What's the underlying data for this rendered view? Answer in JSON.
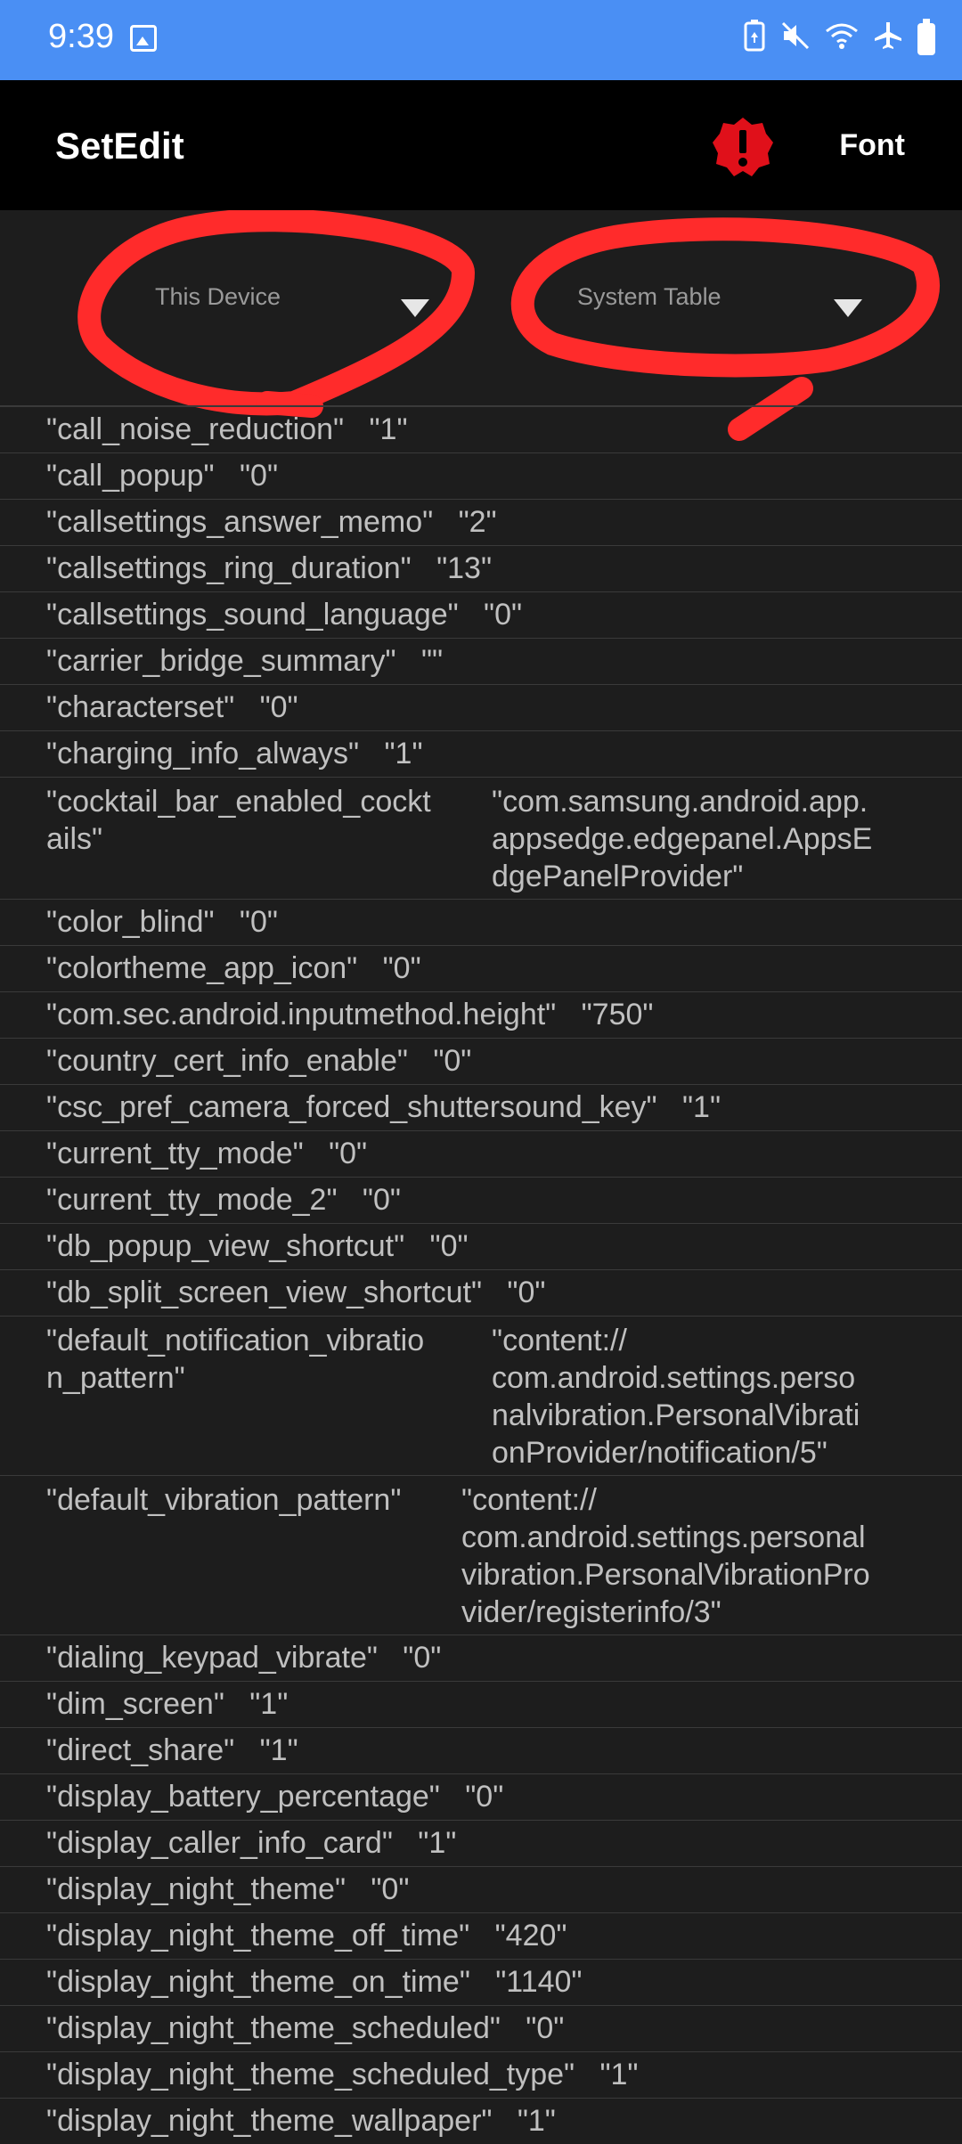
{
  "status_bar": {
    "time": "9:39",
    "icons": [
      "gallery-icon",
      "battery-saver-icon",
      "mute-icon",
      "wifi-icon",
      "airplane-icon",
      "battery-icon"
    ]
  },
  "app_bar": {
    "title": "SetEdit",
    "alert_icon": "alert-icon",
    "font_label": "Font"
  },
  "spinners": {
    "device": "This Device",
    "table": "System Table"
  },
  "colors": {
    "status_bar": "#4a8ff4",
    "app_bar": "#000000",
    "background": "#1d1d1d",
    "annotation": "#ff2b2b",
    "alert": "#e0101a"
  },
  "rows": [
    {
      "key": "\"call_noise_reduction\"",
      "value": "\"1\""
    },
    {
      "key": "\"call_popup\"",
      "value": "\"0\""
    },
    {
      "key": "\"callsettings_answer_memo\"",
      "value": "\"2\""
    },
    {
      "key": "\"callsettings_ring_duration\"",
      "value": "\"13\""
    },
    {
      "key": "\"callsettings_sound_language\"",
      "value": "\"0\""
    },
    {
      "key": "\"carrier_bridge_summary\"",
      "value": "\"\""
    },
    {
      "key": "\"characterset\"",
      "value": "\"0\""
    },
    {
      "key": "\"charging_info_always\"",
      "value": "\"1\""
    },
    {
      "key": "\"cocktail_bar_enabled_cockt\nails\"",
      "value": "\"com.samsung.android.app.\nappsedge.edgepanel.AppsE\ndgePanelProvider\"",
      "multi": true
    },
    {
      "key": "\"color_blind\"",
      "value": "\"0\""
    },
    {
      "key": "\"colortheme_app_icon\"",
      "value": "\"0\""
    },
    {
      "key": "\"com.sec.android.inputmethod.height\"",
      "value": "\"750\""
    },
    {
      "key": "\"country_cert_info_enable\"",
      "value": "\"0\""
    },
    {
      "key": "\"csc_pref_camera_forced_shuttersound_key\"",
      "value": "\"1\""
    },
    {
      "key": "\"current_tty_mode\"",
      "value": "\"0\""
    },
    {
      "key": "\"current_tty_mode_2\"",
      "value": "\"0\""
    },
    {
      "key": "\"db_popup_view_shortcut\"",
      "value": "\"0\""
    },
    {
      "key": "\"db_split_screen_view_shortcut\"",
      "value": "\"0\""
    },
    {
      "key": "\"default_notification_vibratio\nn_pattern\"",
      "value": "\"content://\ncom.android.settings.perso\nnalvibration.PersonalVibrati\nonProvider/notification/5\"",
      "multi": true
    },
    {
      "key": "\"default_vibration_pattern\"",
      "value": "\"content://\ncom.android.settings.personal\nvibration.PersonalVibrationPro\nvider/registerinfo/3\"",
      "multi": true,
      "narrow": true
    },
    {
      "key": "\"dialing_keypad_vibrate\"",
      "value": "\"0\""
    },
    {
      "key": "\"dim_screen\"",
      "value": "\"1\""
    },
    {
      "key": "\"direct_share\"",
      "value": "\"1\""
    },
    {
      "key": "\"display_battery_percentage\"",
      "value": "\"0\""
    },
    {
      "key": "\"display_caller_info_card\"",
      "value": "\"1\""
    },
    {
      "key": "\"display_night_theme\"",
      "value": "\"0\""
    },
    {
      "key": "\"display_night_theme_off_time\"",
      "value": "\"420\""
    },
    {
      "key": "\"display_night_theme_on_time\"",
      "value": "\"1140\""
    },
    {
      "key": "\"display_night_theme_scheduled\"",
      "value": "\"0\""
    },
    {
      "key": "\"display_night_theme_scheduled_type\"",
      "value": "\"1\""
    },
    {
      "key": "\"display_night_theme_wallpaper\"",
      "value": "\"1\""
    }
  ]
}
